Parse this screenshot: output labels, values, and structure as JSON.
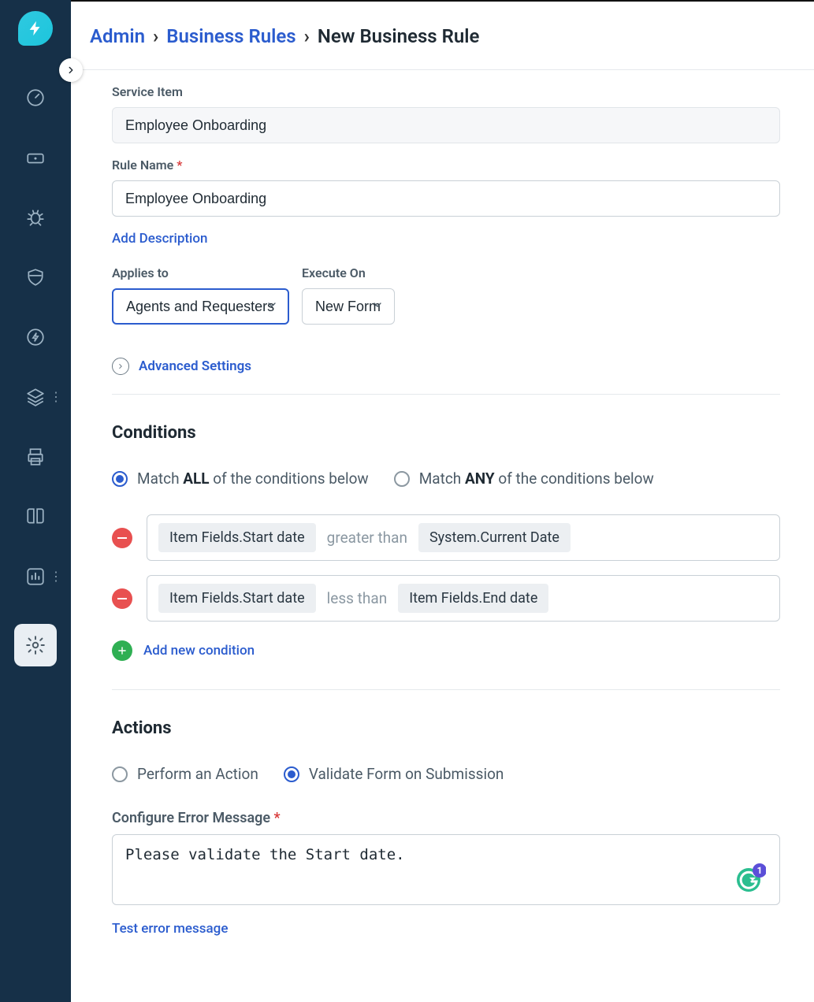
{
  "breadcrumbs": {
    "root": "Admin",
    "section": "Business Rules",
    "current": "New Business Rule"
  },
  "form": {
    "service_item_label": "Service Item",
    "service_item_value": "Employee Onboarding",
    "rule_name_label": "Rule Name",
    "rule_name_value": "Employee Onboarding",
    "add_description": "Add Description",
    "applies_to_label": "Applies to",
    "applies_to_value": "Agents and Requesters",
    "execute_on_label": "Execute On",
    "execute_on_value": "New Form",
    "advanced_settings": "Advanced Settings"
  },
  "conditions": {
    "title": "Conditions",
    "match_all_pre": "Match ",
    "match_all_bold": "ALL",
    "match_all_post": " of the conditions below",
    "match_any_pre": "Match ",
    "match_any_bold": "ANY",
    "match_any_post": " of the conditions below",
    "match_selected": "all",
    "rows": [
      {
        "left": "Item Fields.Start date",
        "op": "greater than",
        "right": "System.Current Date"
      },
      {
        "left": "Item Fields.Start date",
        "op": "less than",
        "right": "Item Fields.End date"
      }
    ],
    "add_new": "Add new condition"
  },
  "actions": {
    "title": "Actions",
    "perform_label": "Perform an Action",
    "validate_label": "Validate Form on Submission",
    "selected": "validate",
    "error_label": "Configure Error Message",
    "error_value": "Please validate the Start date.",
    "test_link": "Test error message",
    "grammarly_count": "1"
  },
  "icons": {
    "nav": [
      "gauge",
      "ticket",
      "bug",
      "shield",
      "bolt",
      "layers",
      "printer",
      "book",
      "analytics",
      "settings"
    ]
  }
}
